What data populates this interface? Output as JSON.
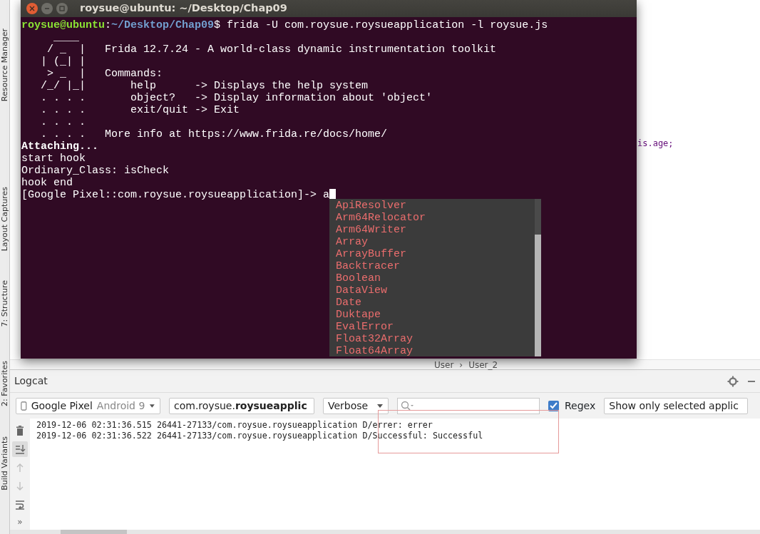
{
  "side_tabs": [
    {
      "label": "Resource Manager"
    },
    {
      "label": "Layout Captures"
    },
    {
      "label": "7: Structure"
    },
    {
      "label": "2: Favorites"
    },
    {
      "label": "Build Variants"
    }
  ],
  "editor": {
    "code_fragment": "is.age;",
    "breadcrumb": [
      "User",
      "User_2"
    ],
    "breadcrumb_separator": "›"
  },
  "terminal": {
    "title": "roysue@ubuntu: ~/Desktop/Chap09",
    "lines": [
      {
        "kind": "prompt",
        "user": "roysue@ubuntu",
        "separator": ":",
        "path": "~/Desktop/Chap09",
        "command": "$ frida -U com.roysue.roysueapplication -l roysue.js"
      },
      {
        "kind": "plain",
        "text": "     ____"
      },
      {
        "kind": "plain",
        "text": "    / _  |   Frida 12.7.24 - A world-class dynamic instrumentation toolkit"
      },
      {
        "kind": "plain",
        "text": "   | (_| |"
      },
      {
        "kind": "plain",
        "text": "    > _  |   Commands:"
      },
      {
        "kind": "plain",
        "text": "   /_/ |_|       help      -> Displays the help system"
      },
      {
        "kind": "plain",
        "text": "   . . . .       object?   -> Display information about 'object'"
      },
      {
        "kind": "plain",
        "text": "   . . . .       exit/quit -> Exit"
      },
      {
        "kind": "plain",
        "text": "   . . . ."
      },
      {
        "kind": "plain",
        "text": "   . . . .   More info at https://www.frida.re/docs/home/"
      },
      {
        "kind": "bold",
        "text": "Attaching..."
      },
      {
        "kind": "plain",
        "text": "start hook"
      },
      {
        "kind": "plain",
        "text": "Ordinary_Class: isCheck"
      },
      {
        "kind": "plain",
        "text": "hook end"
      },
      {
        "kind": "input",
        "text": "[Google Pixel::com.roysue.roysueapplication]-> a",
        "cursor": true
      }
    ],
    "suggestions": [
      "ApiResolver",
      "Arm64Relocator",
      "Arm64Writer",
      "Array",
      "ArrayBuffer",
      "Backtracer",
      "Boolean",
      "DataView",
      "Date",
      "Duktape",
      "EvalError",
      "Float32Array",
      "Float64Array"
    ]
  },
  "logcat": {
    "title": "Logcat",
    "device": {
      "name": "Google Pixel",
      "os": "Android 9"
    },
    "package": "com.roysue.**roysueapplic**",
    "level": "Verbose",
    "regex": {
      "label": "Regex",
      "checked": true
    },
    "filter": "Show only selected applic",
    "tools": [
      {
        "kind": "trash",
        "selected": false,
        "disabled": false
      },
      {
        "kind": "scroll-end",
        "selected": true,
        "disabled": false
      },
      {
        "kind": "up",
        "selected": false,
        "disabled": true
      },
      {
        "kind": "down",
        "selected": false,
        "disabled": true
      },
      {
        "kind": "wrap",
        "selected": false,
        "disabled": false
      }
    ],
    "more": "»",
    "rows": [
      {
        "source": "2019-12-06 02:31:36.515 26441-27133/com.roysue.roysueapplication",
        "message": "D/errer: errer"
      },
      {
        "source": "2019-12-06 02:31:36.522 26441-27133/com.roysue.roysueapplication",
        "message": "D/Successful: Successful"
      }
    ]
  }
}
